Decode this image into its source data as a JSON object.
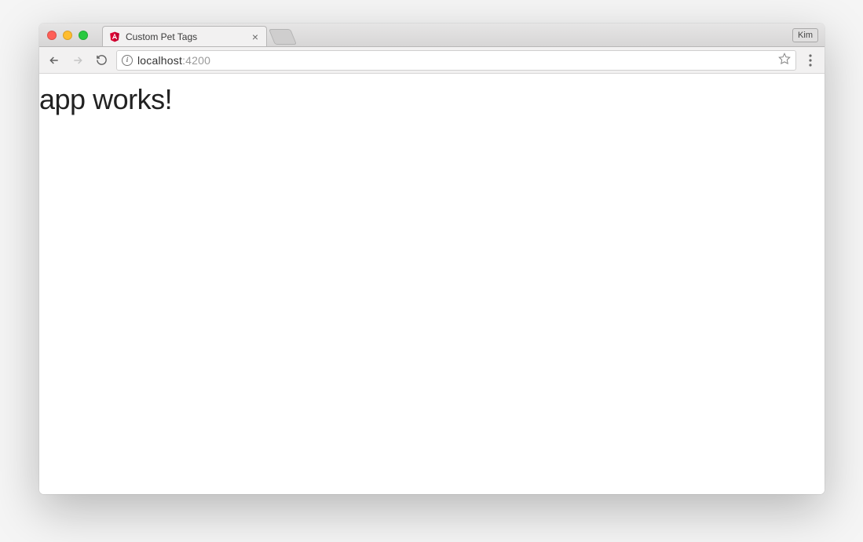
{
  "browser": {
    "profile_name": "Kim",
    "tab": {
      "title": "Custom Pet Tags"
    },
    "address": {
      "host": "localhost",
      "port": ":4200"
    }
  },
  "page": {
    "heading": "app works!"
  }
}
